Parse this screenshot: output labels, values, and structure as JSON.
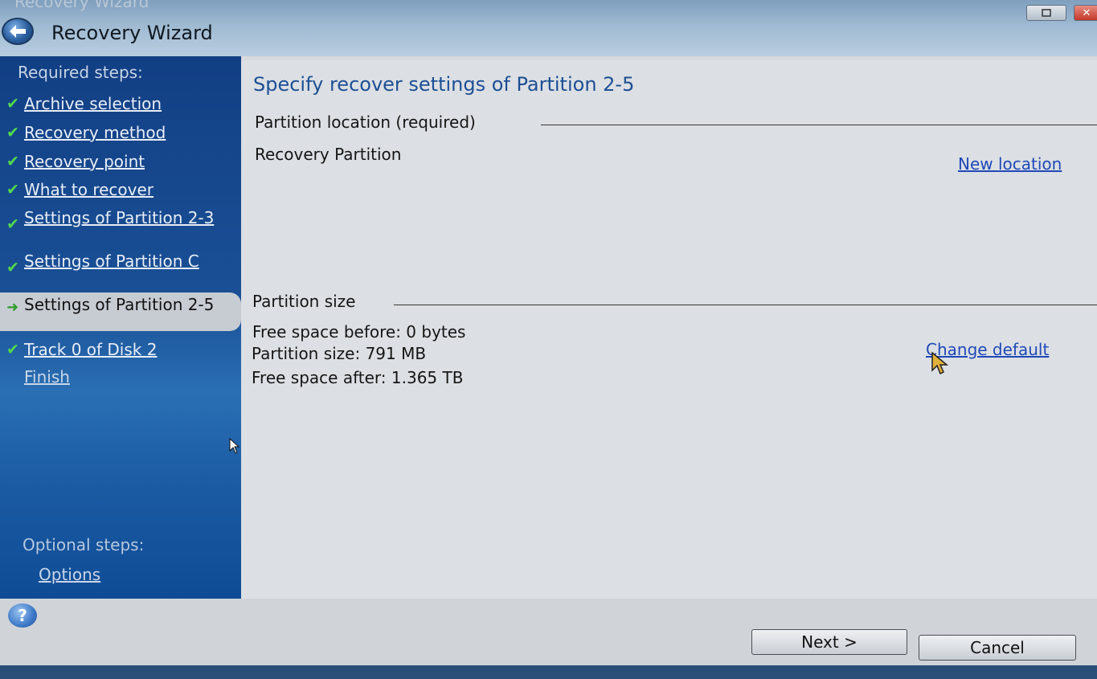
{
  "window": {
    "title_faint": "Recovery Wizard",
    "title": "Recovery Wizard",
    "restore_icon": "restore-icon",
    "close_label": "✕"
  },
  "sidebar": {
    "required_heading": "Required steps:",
    "steps": [
      {
        "label": "Archive selection",
        "state": "done"
      },
      {
        "label": "Recovery method",
        "state": "done"
      },
      {
        "label": "Recovery point",
        "state": "done"
      },
      {
        "label": "What to recover",
        "state": "done"
      },
      {
        "label": "Settings of Partition 2-3",
        "state": "done"
      },
      {
        "label": "Settings of Partition C",
        "state": "done"
      },
      {
        "label": "Settings of Partition 2-5",
        "state": "current"
      },
      {
        "label": "Track 0 of Disk 2",
        "state": "done"
      },
      {
        "label": "Finish",
        "state": "pending"
      }
    ],
    "optional_heading": "Optional steps:",
    "optional_steps": [
      {
        "label": "Options"
      }
    ]
  },
  "main": {
    "heading": "Specify recover settings of Partition 2-5",
    "location": {
      "label": "Partition location (required)",
      "value": "Recovery Partition",
      "link": "New location"
    },
    "size": {
      "label": "Partition size",
      "free_before": "Free space before: 0 bytes",
      "partition_size": "Partition size: 791 MB",
      "free_after": "Free space after: 1.365 TB",
      "link": "Change default"
    }
  },
  "footer": {
    "help_icon": "?",
    "next_label": "Next >",
    "cancel_label": "Cancel"
  },
  "colors": {
    "sidebar_blue": "#1a5096",
    "heading_blue": "#1c4f95",
    "link_blue": "#1f49b8",
    "check_green": "#52d84d"
  }
}
